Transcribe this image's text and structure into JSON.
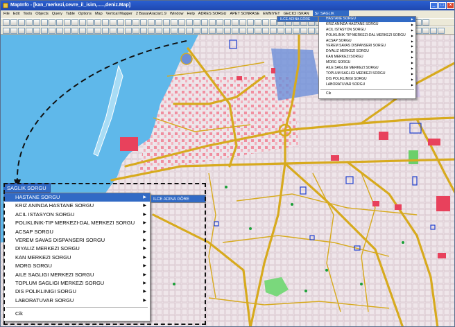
{
  "window": {
    "title": "MapInfo - [kan_merkezi,cevre_il_isim,.....,deniz.Map]"
  },
  "menubar": {
    "items": [
      "File",
      "Edit",
      "Tools",
      "Objects",
      "Query",
      "Table",
      "Options",
      "Map",
      "Vertical Mapper",
      "2 BasarAraclar1.9",
      "Window",
      "Help",
      "ADRES SORGU",
      "APET SONRASE",
      "EMNIYET",
      "GECICI ISKAN",
      "SAGLIK SORGU"
    ]
  },
  "menu": {
    "title": "SAGLIK SORGU",
    "submenu_label": "ILCE ADINA GÖRE",
    "items": [
      {
        "label": "HASTANE SORGU",
        "arrow": true,
        "selected": true
      },
      {
        "label": "KRIZ ANINDA HASTANE SORGU",
        "arrow": true
      },
      {
        "label": "ACIL ISTASYON SORGU",
        "arrow": true
      },
      {
        "label": "POLIKLINIK-TIP MERKEZI-DAL MERKEZI SORGU",
        "arrow": true
      },
      {
        "label": "ACSAP SORGU",
        "arrow": true
      },
      {
        "label": "VEREM SAVAS DISPANSERI SORGU",
        "arrow": true
      },
      {
        "label": "DIYALIZ MERKEZI SORGU",
        "arrow": true
      },
      {
        "label": "KAN MERKEZI SORGU",
        "arrow": true
      },
      {
        "label": "MORG SORGU",
        "arrow": true
      },
      {
        "label": "AILE SAGLIGI MERKEZI SORGU",
        "arrow": true
      },
      {
        "label": "TOPLUM SAGLIGI MERKEZI SORGU",
        "arrow": true
      },
      {
        "label": "DIS POLIKLINIGI SORGU",
        "arrow": true
      },
      {
        "label": "LABORATUVAR SORGU",
        "arrow": true
      }
    ],
    "exit_label": "Cik"
  },
  "colors": {
    "sea": "#5fb8ea",
    "land": "#e7dfe3",
    "road": "#d7aa1e",
    "highlight": "#316ac5"
  }
}
